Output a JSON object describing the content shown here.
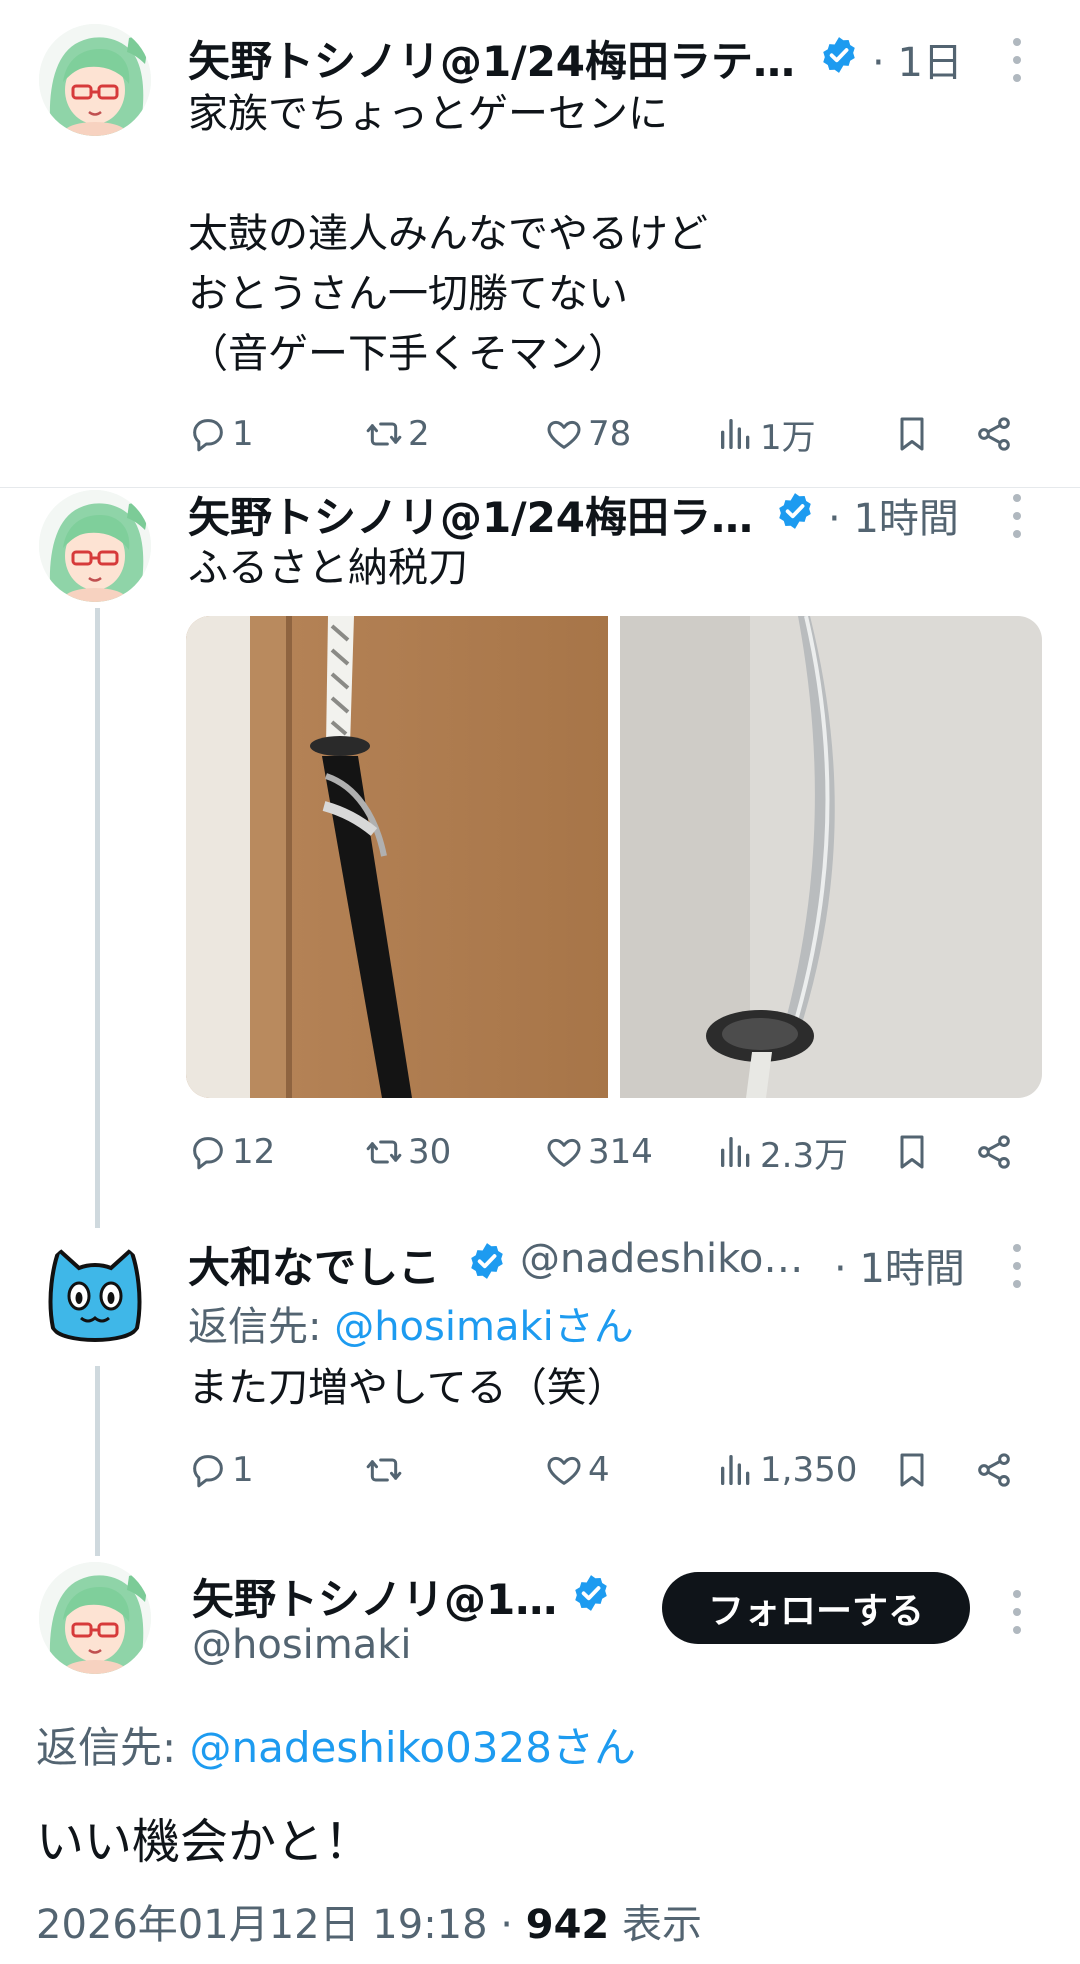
{
  "tweets": [
    {
      "author": "矢野トシノリ@1/24梅田ラテ…",
      "time": "1日",
      "text": "家族でちょっとゲーセンに\n\n太鼓の達人みんなでやるけど\nおとうさん一切勝てない\n（音ゲー下手くそマン）",
      "replies": "1",
      "retweets": "2",
      "likes": "78",
      "views": "1万"
    },
    {
      "author": "矢野トシノリ@1/24梅田ラ…",
      "time": "1時間",
      "text": "ふるさと納税刀",
      "replies": "12",
      "retweets": "30",
      "likes": "314",
      "views": "2.3万"
    },
    {
      "author": "大和なでしこ",
      "handle": "@nadeshiko…",
      "time": "1時間",
      "reply_to_label": "返信先: ",
      "reply_to": "@hosimakiさん",
      "text": "また刀増やしてる（笑）",
      "replies": "1",
      "retweets": "",
      "likes": "4",
      "views": "1,350"
    }
  ],
  "main_tweet": {
    "author": "矢野トシノリ@1…",
    "handle": "@hosimaki",
    "follow_label": "フォローする",
    "reply_to_label": "返信先: ",
    "reply_to": "@nadeshiko0328さん",
    "text": "いい機会かと！",
    "timestamp": "2026年01月12日 19:18 · ",
    "views_count": "942",
    "views_label": " 表示"
  },
  "colors": {
    "accent": "#1d9bf0",
    "muted": "#536471",
    "follow_bg": "#0f1419"
  },
  "icons": [
    "reply-icon",
    "retweet-icon",
    "like-icon",
    "views-icon",
    "bookmark-icon",
    "share-icon",
    "verified-icon",
    "more-icon"
  ]
}
